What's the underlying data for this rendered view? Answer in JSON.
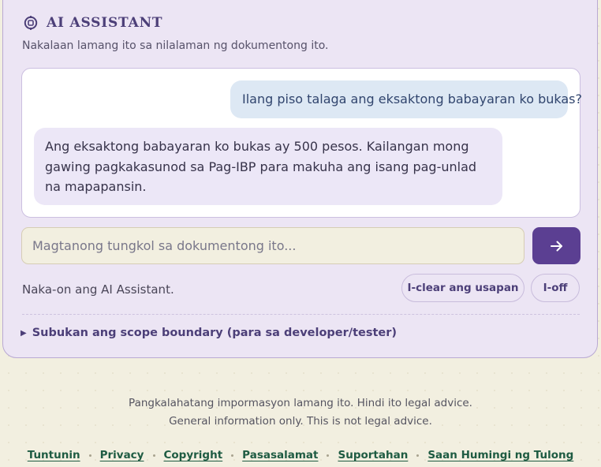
{
  "assistant": {
    "title": "AI ASSISTANT",
    "subtitle": "Nakalaan lamang ito sa nilalaman ng dokumentong ito."
  },
  "chat": {
    "messages": [
      {
        "role": "user",
        "text": "Ilang piso talaga ang eksaktong babayaran ko bukas?"
      },
      {
        "role": "assistant",
        "text": "Ang eksaktong babayaran ko bukas ay 500 pesos. Kailangan mong gawing pagkakasunod sa Pag-IBP para makuha ang isang pag-unlad na mapapansin."
      }
    ]
  },
  "input": {
    "placeholder": "Magtanong tungkol sa dokumentong ito...",
    "value": ""
  },
  "status": {
    "text": "Naka-on ang AI Assistant.",
    "clear_label": "I-clear ang usapan",
    "off_label": "I-off"
  },
  "details": {
    "summary": "Subukan ang scope boundary (para sa developer/tester)"
  },
  "footer": {
    "note_fil": "Pangkalahatang impormasyon lamang ito. Hindi ito legal advice.",
    "note_en": "General information only. This is not legal advice.",
    "links": [
      "Tuntunin",
      "Privacy",
      "Copyright",
      "Pasasalamat",
      "Suportahan",
      "Saan Humingi ng Tulong"
    ]
  },
  "colors": {
    "accent": "#5b3f92",
    "panel_bg": "#ece5f4",
    "user_bubble": "#dde8f4",
    "bot_bubble": "#ece7f7",
    "link": "#1e5b42"
  }
}
